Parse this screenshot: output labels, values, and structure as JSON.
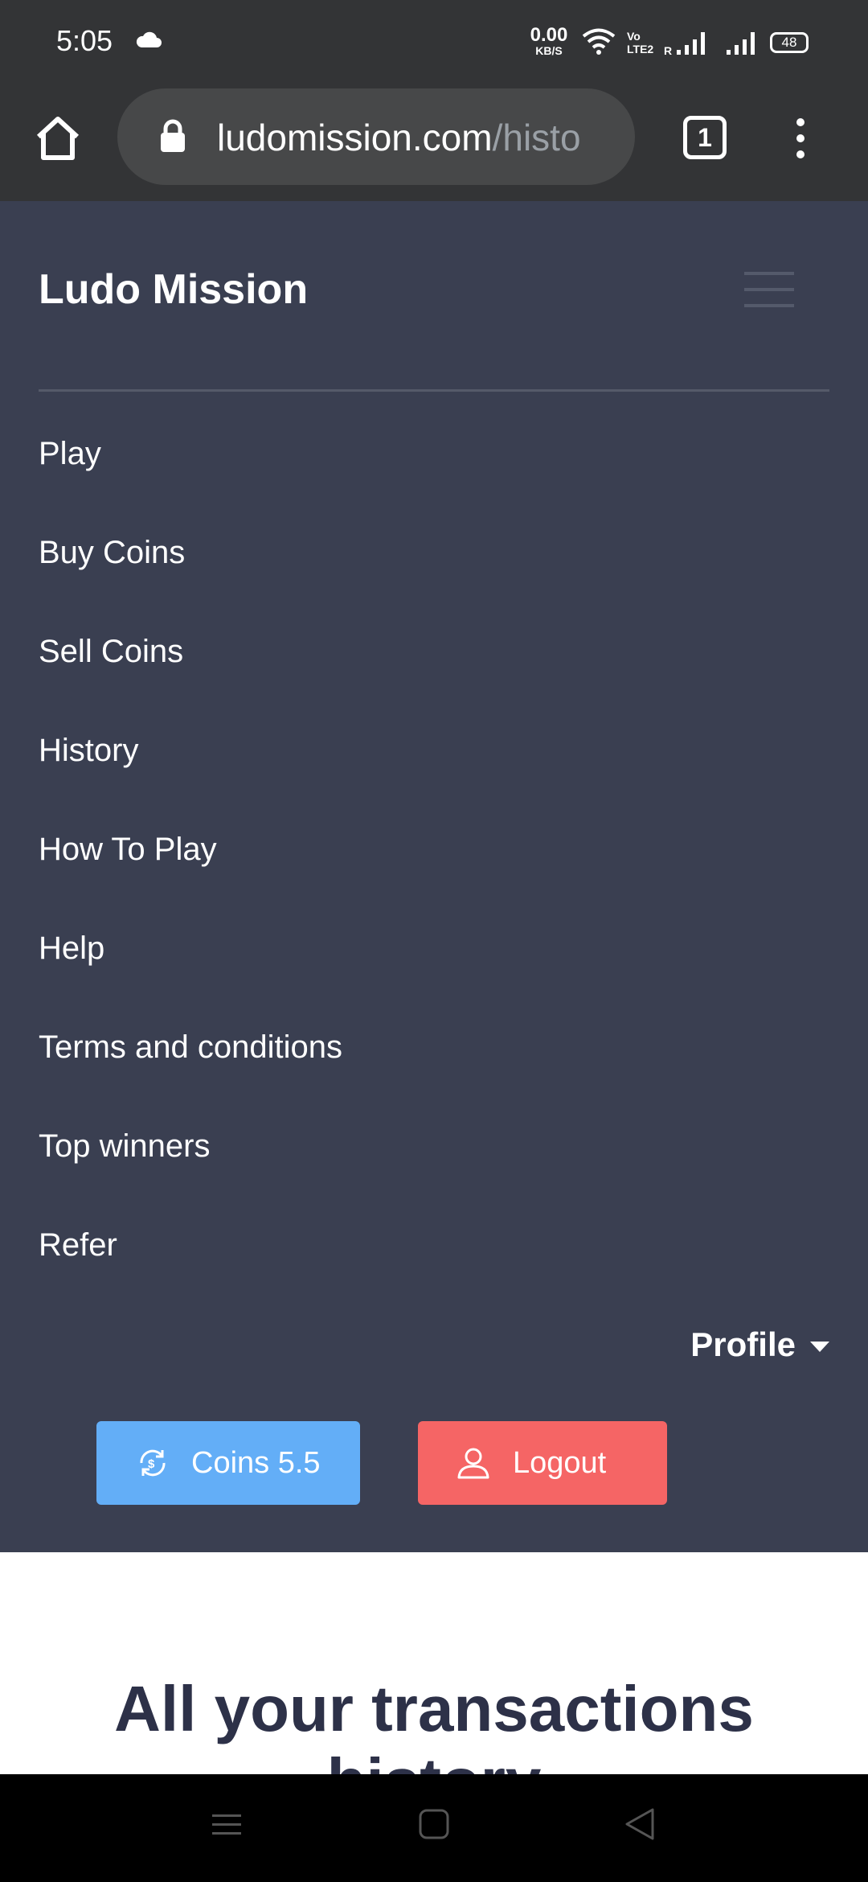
{
  "status_bar": {
    "time": "5:05",
    "net_speed_value": "0.00",
    "net_speed_unit": "KB/S",
    "battery": "48"
  },
  "browser": {
    "url_domain": "ludomission.com",
    "url_path": "/histo",
    "tab_count": "1"
  },
  "site": {
    "brand": "Ludo Mission",
    "nav_items": [
      {
        "label": "Play"
      },
      {
        "label": "Buy Coins"
      },
      {
        "label": "Sell Coins"
      },
      {
        "label": "History"
      },
      {
        "label": "How To Play"
      },
      {
        "label": "Help"
      },
      {
        "label": "Terms and conditions"
      },
      {
        "label": "Top winners"
      },
      {
        "label": "Refer"
      }
    ],
    "profile_label": "Profile",
    "coins_label": "Coins 5.5",
    "logout_label": "Logout"
  },
  "content": {
    "title": "All your transactions history"
  },
  "colors": {
    "navbar_bg": "#3a3f51",
    "coins_button": "#63aef7",
    "logout_button": "#f56565",
    "title_text": "#2d3148"
  }
}
